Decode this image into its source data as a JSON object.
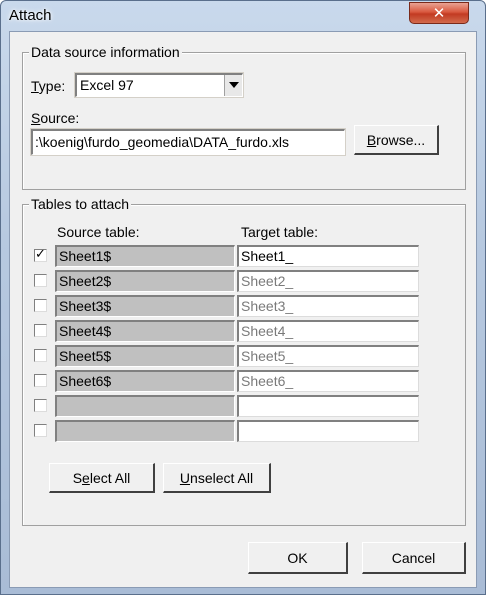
{
  "window": {
    "title": "Attach",
    "close_glyph": "✕"
  },
  "data_source": {
    "group_label": "Data source information",
    "type_label": "Type:",
    "type_value": "Excel 97",
    "source_label": "Source:",
    "source_value": ":\\koenig\\furdo_geomedia\\DATA_furdo.xls",
    "browse_label": "Browse..."
  },
  "tables": {
    "group_label": "Tables to attach",
    "col_source": "Source table:",
    "col_target": "Target table:",
    "rows": [
      {
        "checked": true,
        "source": "Sheet1$",
        "target": "Sheet1_",
        "target_active": true
      },
      {
        "checked": false,
        "source": "Sheet2$",
        "target": "Sheet2_",
        "target_active": false
      },
      {
        "checked": false,
        "source": "Sheet3$",
        "target": "Sheet3_",
        "target_active": false
      },
      {
        "checked": false,
        "source": "Sheet4$",
        "target": "Sheet4_",
        "target_active": false
      },
      {
        "checked": false,
        "source": "Sheet5$",
        "target": "Sheet5_",
        "target_active": false
      },
      {
        "checked": false,
        "source": "Sheet6$",
        "target": "Sheet6_",
        "target_active": false
      },
      {
        "checked": false,
        "source": "",
        "target": "",
        "target_active": false
      },
      {
        "checked": false,
        "source": "",
        "target": "",
        "target_active": false
      }
    ],
    "select_all_label": "Select All",
    "unselect_all_label": "Unselect All"
  },
  "footer": {
    "ok_label": "OK",
    "cancel_label": "Cancel"
  },
  "colors": {
    "dialog_face": "#f0f0f0",
    "disabled_cell": "#c0c0c0",
    "close_button": "#c94a31"
  }
}
